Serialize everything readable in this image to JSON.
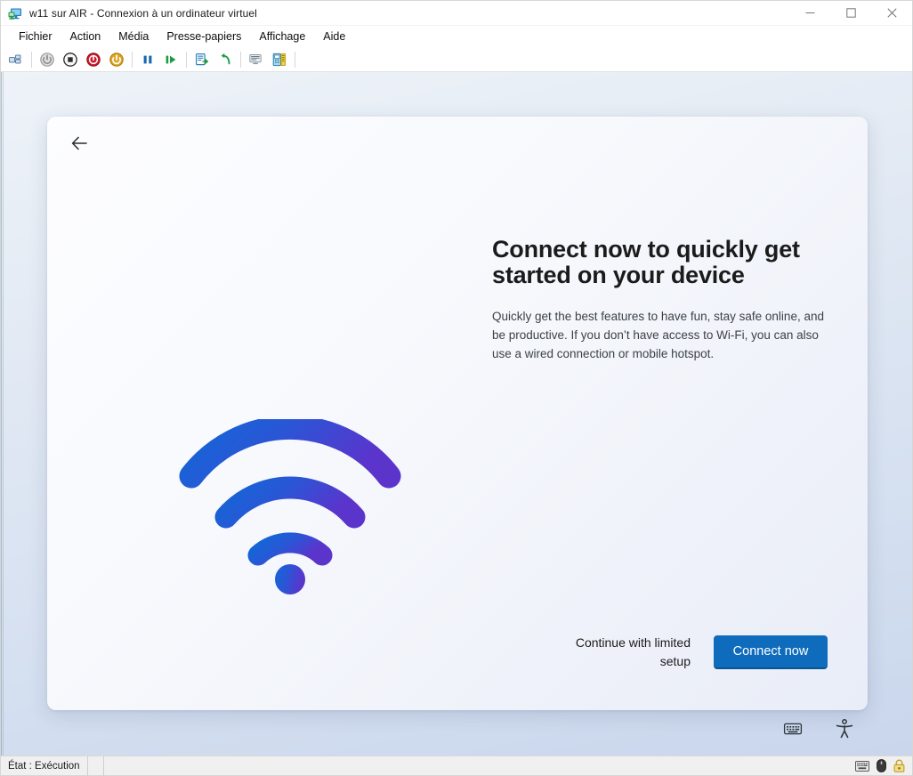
{
  "window": {
    "title": "w11 sur AIR - Connexion à un ordinateur virtuel",
    "icon": "virtual-machine-icon",
    "controls": {
      "minimize": "‒",
      "maximize": "☐",
      "close": "✕"
    }
  },
  "menubar": {
    "items": [
      {
        "label": "Fichier"
      },
      {
        "label": "Action"
      },
      {
        "label": "Média"
      },
      {
        "label": "Presse-papiers"
      },
      {
        "label": "Affichage"
      },
      {
        "label": "Aide"
      }
    ]
  },
  "toolbar": {
    "groups": [
      {
        "buttons": [
          {
            "icon": "ctrl-alt-del-icon",
            "name": "ctrl-alt-del-button"
          }
        ]
      },
      {
        "buttons": [
          {
            "icon": "power-off-icon",
            "name": "power-off-button"
          },
          {
            "icon": "shutdown-icon",
            "name": "shutdown-button"
          },
          {
            "icon": "turn-off-icon",
            "name": "turn-off-button"
          },
          {
            "icon": "start-icon",
            "name": "start-button"
          }
        ]
      },
      {
        "buttons": [
          {
            "icon": "pause-icon",
            "name": "pause-button"
          },
          {
            "icon": "resume-icon",
            "name": "resume-button"
          }
        ]
      },
      {
        "buttons": [
          {
            "icon": "checkpoint-icon",
            "name": "checkpoint-button"
          },
          {
            "icon": "revert-icon",
            "name": "revert-button"
          }
        ]
      },
      {
        "buttons": [
          {
            "icon": "basic-session-icon",
            "name": "basic-session-button"
          },
          {
            "icon": "enhanced-session-icon",
            "name": "enhanced-session-button"
          }
        ]
      }
    ]
  },
  "oobe": {
    "back_label": "Back",
    "title": "Connect now to quickly get started on your device",
    "body": "Quickly get the best features to have fun, stay safe online, and be productive. If you don’t have access to Wi-Fi, you can also use a wired connection or mobile hotspot.",
    "graphic": "wifi-icon",
    "limited_setup_label": "Continue with limited setup",
    "connect_label": "Connect now",
    "utilities": [
      {
        "icon": "on-screen-keyboard-icon",
        "name": "on-screen-keyboard-button"
      },
      {
        "icon": "accessibility-icon",
        "name": "accessibility-button"
      }
    ],
    "colors": {
      "accent": "#0f6cbd",
      "accent_border": "#0a548f",
      "wifi_gradient_start": "#1366d6",
      "wifi_gradient_end": "#5b34cc"
    }
  },
  "statusbar": {
    "state_label": "État : Exécution",
    "icons": [
      {
        "icon": "keyboard-icon",
        "name": "status-keyboard-icon"
      },
      {
        "icon": "mouse-icon",
        "name": "status-mouse-icon"
      },
      {
        "icon": "lock-icon",
        "name": "status-lock-icon"
      }
    ]
  }
}
